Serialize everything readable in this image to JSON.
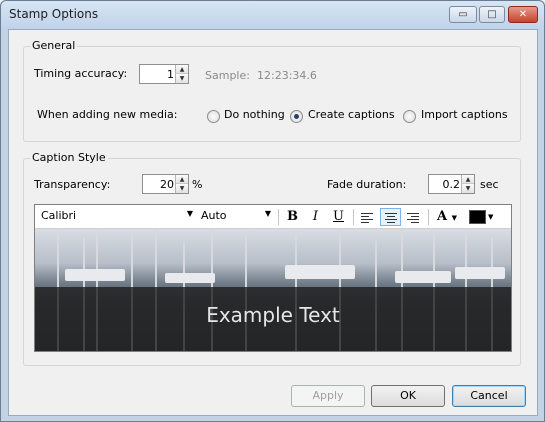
{
  "window": {
    "title": "Stamp Options",
    "controls": {
      "minimize": "▭",
      "maximize": "□",
      "close": "✕"
    }
  },
  "general": {
    "legend": "General",
    "timing_label": "Timing accuracy:",
    "timing_value": "1",
    "sample_label": "Sample:",
    "sample_value": "12:23:34.6",
    "media_label": "When adding new media:",
    "media_options": [
      "Do nothing",
      "Create captions",
      "Import captions"
    ],
    "media_selected": "Create captions"
  },
  "caption_style": {
    "legend": "Caption Style",
    "transparency_label": "Transparency:",
    "transparency_value": "20",
    "transparency_unit": "%",
    "fade_label": "Fade duration:",
    "fade_value": "0.2",
    "fade_unit": "sec",
    "font": "Calibri",
    "size": "Auto",
    "bold": "B",
    "italic": "I",
    "underline": "U",
    "font_color_glyph": "A",
    "alignment_selected": "center",
    "text_color": "#000000",
    "preview_text": "Example Text"
  },
  "buttons": {
    "apply": "Apply",
    "ok": "OK",
    "cancel": "Cancel"
  }
}
